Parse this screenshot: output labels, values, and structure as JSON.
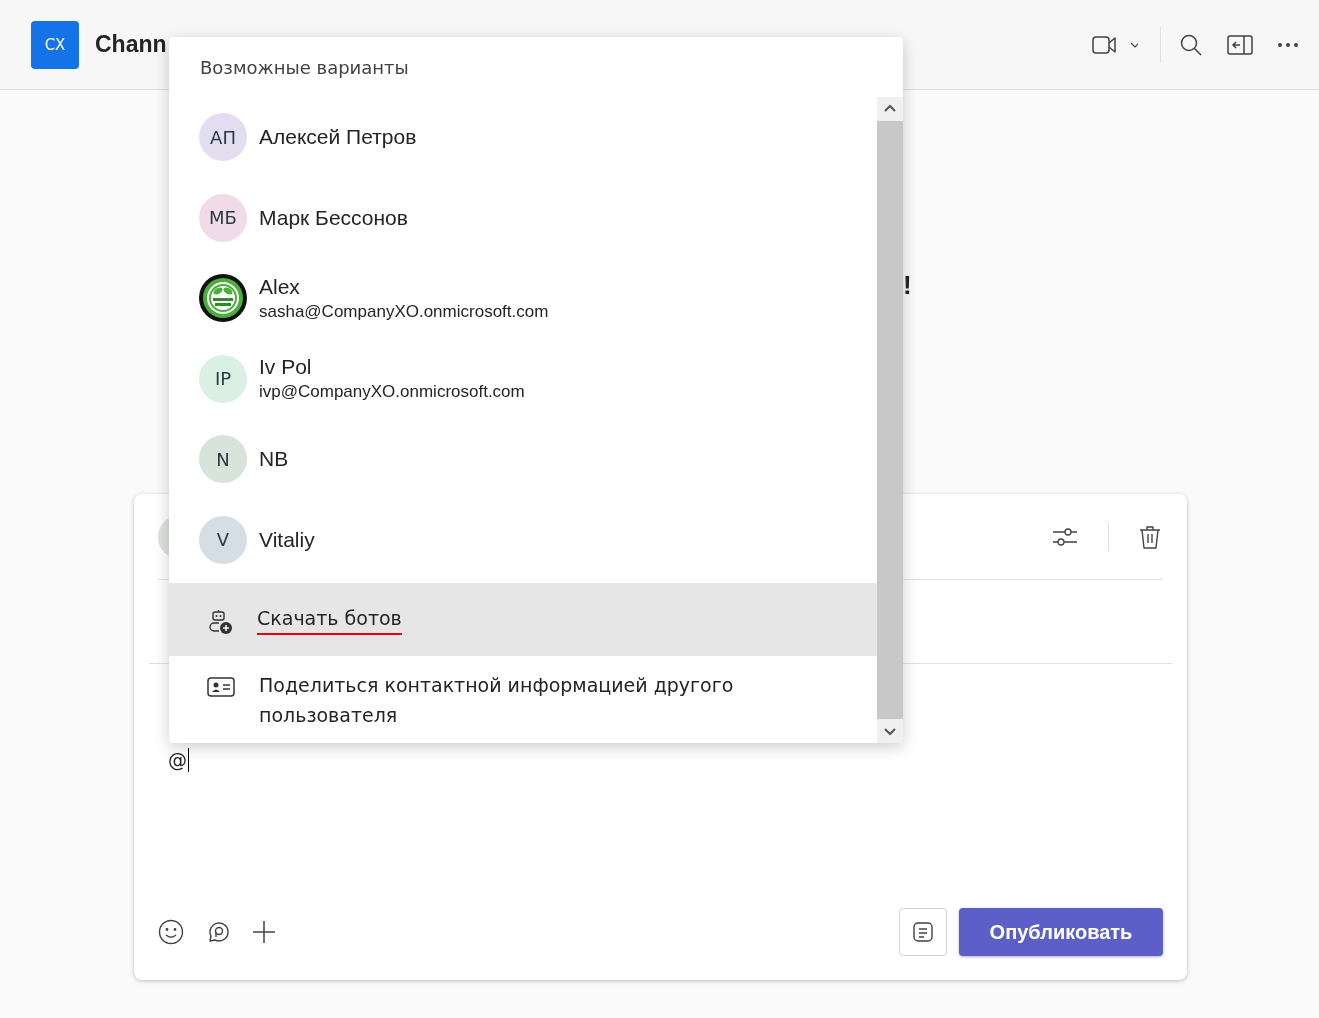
{
  "header": {
    "badge": "CX",
    "title": "Chann"
  },
  "post_fragment": "!",
  "composer": {
    "text": "@",
    "publish_button": "Опубликовать"
  },
  "suggestions": {
    "title": "Возможные варианты",
    "people": [
      {
        "kind": "initials",
        "initials": "АП",
        "name": "Алексей Петров",
        "color": "#e2def0"
      },
      {
        "kind": "initials",
        "initials": "МБ",
        "name": "Марк Бессонов",
        "color": "#f1dbe8"
      },
      {
        "kind": "picture",
        "name": "Alex",
        "email": "sasha@CompanyXO.onmicrosoft.com"
      },
      {
        "kind": "initials",
        "initials": "IP",
        "name": "Iv Pol",
        "email": "ivp@CompanyXO.onmicrosoft.com",
        "color": "#daf0e2"
      },
      {
        "kind": "initials",
        "initials": "N",
        "name": "NB",
        "color": "#d6e4d9"
      },
      {
        "kind": "initials",
        "initials": "V",
        "name": "Vitaliy",
        "color": "#d4dee4"
      }
    ],
    "actions": [
      {
        "kind": "bots",
        "label": "Скачать ботов",
        "selected": true,
        "underlined": true
      },
      {
        "kind": "contact",
        "label": "Поделиться контактной информацией другого пользователя",
        "selected": false,
        "underlined": false
      }
    ]
  }
}
